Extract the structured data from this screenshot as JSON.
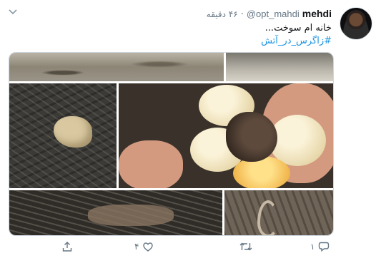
{
  "tweet": {
    "author_name": "mehdi",
    "author_handle": "@opt_mahdi",
    "separator": "·",
    "timestamp": "۴۶ دقیقه",
    "text": "خانه ام سوخت...",
    "hashtag": "#زاگرس_در_آتش"
  },
  "media": {
    "tiles": [
      {
        "name": "smoke-landscape-photo"
      },
      {
        "name": "burned-hillside-photo"
      },
      {
        "name": "burned-animal-photo"
      },
      {
        "name": "eggs-in-hand-photo"
      },
      {
        "name": "charred-ground-photo"
      },
      {
        "name": "snake-on-ground-photo"
      }
    ]
  },
  "actions": {
    "reply_count": "۱",
    "retweet_count": "",
    "like_count": "۴",
    "share_count": ""
  },
  "colors": {
    "accent": "#1b95e0",
    "muted": "#657786",
    "text": "#14171a"
  }
}
